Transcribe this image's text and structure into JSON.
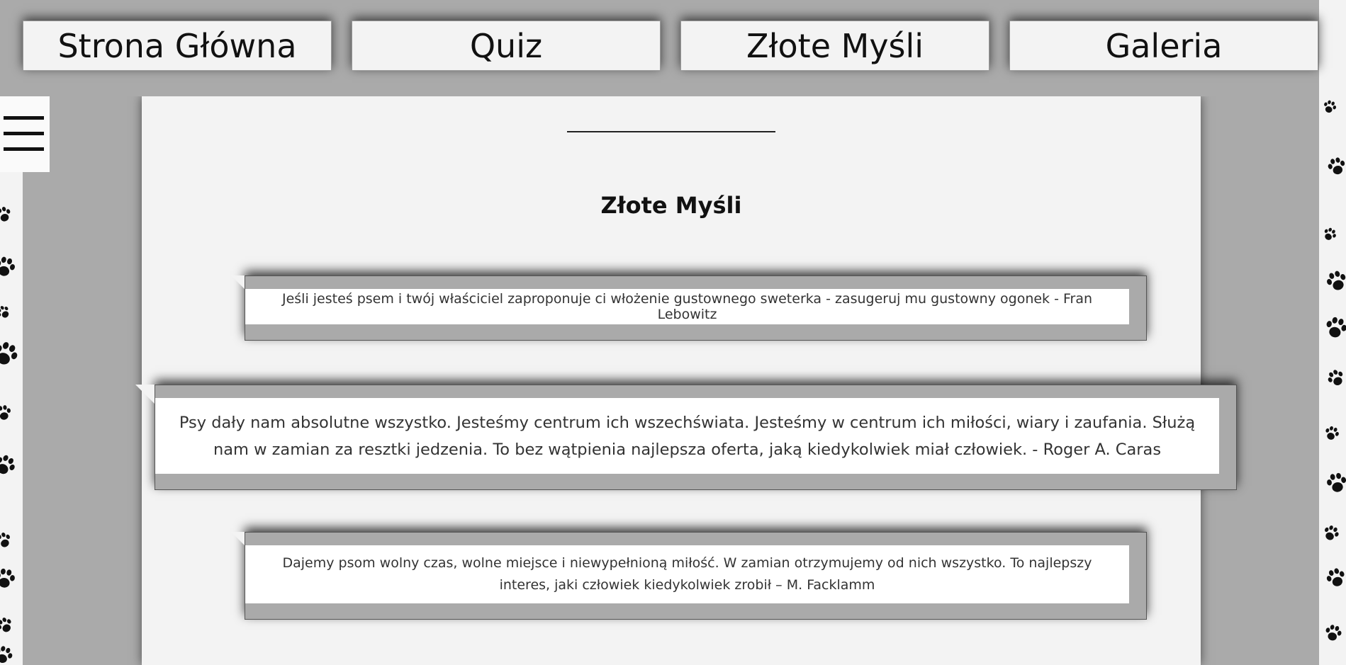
{
  "nav": {
    "items": [
      {
        "label": "Strona Główna"
      },
      {
        "label": "Quiz"
      },
      {
        "label": "Złote Myśli"
      },
      {
        "label": "Galeria"
      }
    ]
  },
  "menu": {
    "icon": "hamburger-menu-icon"
  },
  "page": {
    "title": "Złote Myśli"
  },
  "quotes": [
    {
      "text": "Jeśli jesteś psem i twój właściciel zaproponuje ci włożenie gustownego sweterka - zasugeruj mu gustowny ogonek - Fran Lebowitz"
    },
    {
      "text": "Psy dały nam absolutne wszystko. Jesteśmy centrum ich wszechświata. Jesteśmy w centrum ich miłości, wiary i zaufania. Służą nam w zamian za resztki jedzenia. To bez wątpienia najlepsza oferta, jaką kiedykolwiek miał człowiek. - Roger A. Caras"
    },
    {
      "text": "Dajemy psom wolny czas, wolne miejsce i niewypełnioną miłość. W zamian otrzymujemy od nich wszystko. To najlepszy interes, jaki człowiek kiedykolwiek zrobił – M. Facklamm"
    }
  ],
  "background": {
    "pattern_icon": "paw-print-icon"
  },
  "colors": {
    "page_bg": "#aaaaaa",
    "panel_bg": "#f3f3f3",
    "card_bg": "#ffffff",
    "text": "#111111"
  }
}
